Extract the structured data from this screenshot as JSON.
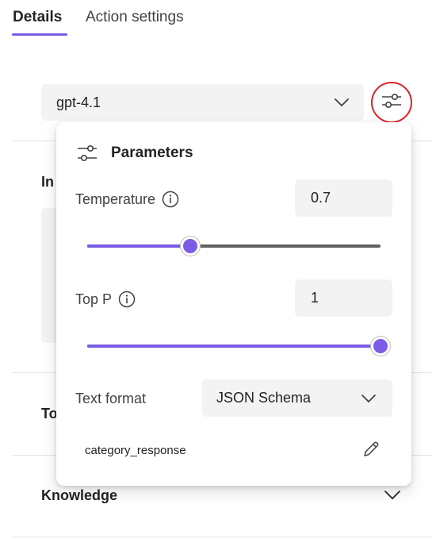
{
  "tabs": [
    {
      "label": "Details",
      "active": true
    },
    {
      "label": "Action settings",
      "active": false
    }
  ],
  "model": {
    "selected": "gpt-4.1"
  },
  "background": {
    "sections": [
      "In",
      "To",
      "Knowledge"
    ]
  },
  "parameters": {
    "title": "Parameters",
    "temperature": {
      "label": "Temperature",
      "value": "0.7",
      "slider_fraction": 0.35
    },
    "top_p": {
      "label": "Top P",
      "value": "1",
      "slider_fraction": 1.0
    },
    "text_format": {
      "label": "Text format",
      "selected": "JSON Schema"
    },
    "schema_name": "category_response"
  },
  "colors": {
    "accent": "#7b5ce6",
    "highlight_circle": "#d9262a"
  },
  "icons": [
    "chevron-down-icon",
    "sliders-icon",
    "info-icon",
    "pencil-icon"
  ]
}
